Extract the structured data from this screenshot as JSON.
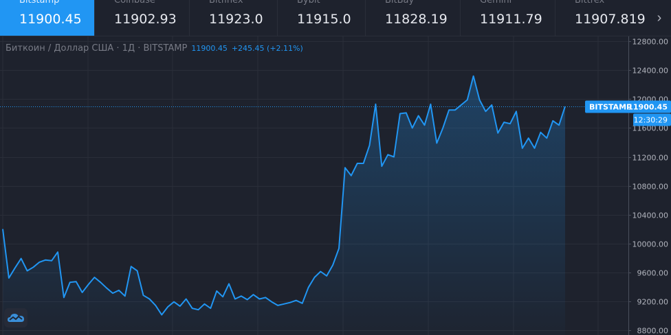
{
  "tabs": [
    {
      "exchange": "Bitstamp",
      "price": "11900.45",
      "active": true
    },
    {
      "exchange": "Coinbase",
      "price": "11902.93",
      "active": false
    },
    {
      "exchange": "Bitfinex",
      "price": "11923.0",
      "active": false
    },
    {
      "exchange": "Bybit",
      "price": "11915.0",
      "active": false
    },
    {
      "exchange": "BitBay",
      "price": "11828.19",
      "active": false
    },
    {
      "exchange": "Gemini",
      "price": "11911.79",
      "active": false
    },
    {
      "exchange": "Bittrex",
      "price": "11907.819",
      "active": false
    }
  ],
  "legend": {
    "symbol": "Биткоин / Доллар США · 1Д · BITSTAMP",
    "price": "11900.45",
    "change": "+245.45 (+2.11%)"
  },
  "price_label": {
    "exchange": "BITSTAMP",
    "price": "11900.45",
    "countdown": "12:30:29"
  },
  "colors": {
    "background": "#1e222d",
    "accent": "#2196f3",
    "grid": "#2a2e39",
    "axis_text": "#b2b5be"
  },
  "icons": {
    "logo": "cloud-logo-icon",
    "scroll": "chevron-right-icon"
  },
  "chart_data": {
    "type": "area",
    "title": "",
    "xlabel": "",
    "ylabel": "",
    "ylim": [
      8730,
      12880
    ],
    "yticks": [
      8800,
      9200,
      9600,
      10000,
      10400,
      10800,
      11200,
      11600,
      12000,
      12400,
      12800
    ],
    "ytick_labels": [
      "8800.00",
      "9200.00",
      "9600.00",
      "10000.00",
      "10400.00",
      "10800.00",
      "11200.00",
      "11600.00",
      "12000.00",
      "12400.00",
      "12800.00"
    ],
    "grid": true,
    "last_value": 11900.45,
    "series": [
      {
        "values": [
          10200,
          9520,
          9660,
          9790,
          9620,
          9670,
          9740,
          9770,
          9760,
          9880,
          9250,
          9460,
          9470,
          9320,
          9430,
          9530,
          9460,
          9380,
          9310,
          9350,
          9270,
          9680,
          9620,
          9280,
          9230,
          9140,
          9010,
          9120,
          9190,
          9130,
          9230,
          9100,
          9080,
          9160,
          9100,
          9340,
          9260,
          9440,
          9230,
          9270,
          9220,
          9290,
          9230,
          9250,
          9190,
          9140,
          9160,
          9180,
          9210,
          9170,
          9390,
          9530,
          9610,
          9550,
          9700,
          9930,
          11050,
          10940,
          11110,
          11110,
          11360,
          11930,
          11070,
          11230,
          11200,
          11800,
          11810,
          11600,
          11770,
          11640,
          11930,
          11390,
          11600,
          11850,
          11850,
          11920,
          11990,
          12320,
          11990,
          11830,
          11920,
          11530,
          11680,
          11660,
          11830,
          11320,
          11460,
          11320,
          11540,
          11460,
          11700,
          11640,
          11900.45
        ]
      }
    ]
  }
}
